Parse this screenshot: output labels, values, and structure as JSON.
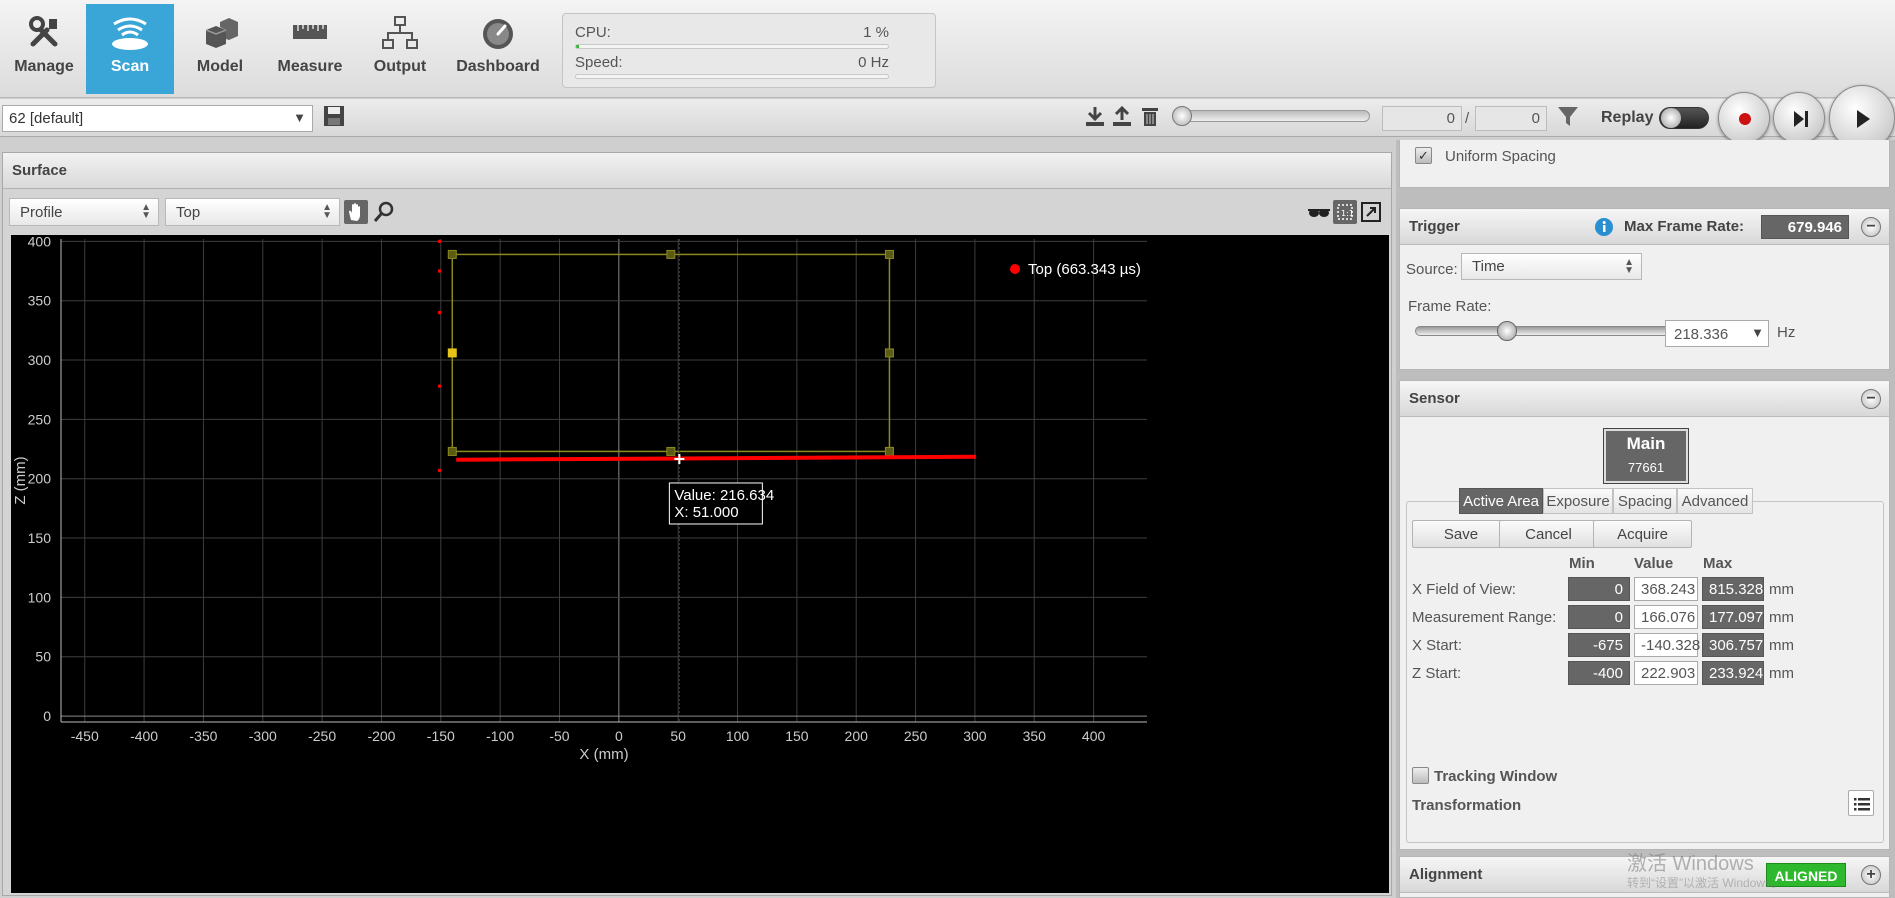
{
  "nav": {
    "items": [
      {
        "label": "Manage",
        "icon": "tools-icon"
      },
      {
        "label": "Scan",
        "icon": "scan-icon"
      },
      {
        "label": "Model",
        "icon": "cubes-icon"
      },
      {
        "label": "Measure",
        "icon": "ruler-icon"
      },
      {
        "label": "Output",
        "icon": "network-icon"
      },
      {
        "label": "Dashboard",
        "icon": "gauge-icon"
      }
    ],
    "active": "Scan"
  },
  "stats": {
    "cpu_label": "CPU:",
    "cpu_value": "1 %",
    "cpu_level": 0.01,
    "speed_label": "Speed:",
    "speed_value": "0 Hz",
    "speed_level": 0
  },
  "toolbar": {
    "job": "62 [default]",
    "frame_current": "0",
    "frame_separator": "/",
    "frame_total": "0",
    "replay_label": "Replay"
  },
  "surface": {
    "title": "Surface",
    "view_mode": "Profile",
    "view_source": "Top"
  },
  "chart_data": {
    "type": "scatter",
    "xlabel": "X (mm)",
    "ylabel": "Z (mm)",
    "xlim": [
      -470,
      445
    ],
    "ylim": [
      -5,
      402
    ],
    "xticks": [
      -450,
      -400,
      -350,
      -300,
      -250,
      -200,
      -150,
      -100,
      -50,
      0,
      50,
      100,
      150,
      200,
      250,
      300,
      350,
      400
    ],
    "yticks": [
      0,
      50,
      100,
      150,
      200,
      250,
      300,
      350,
      400
    ],
    "grid": true,
    "legend": {
      "position": "top-right",
      "label": "Top (663.343 µs)",
      "color": "#ff0000"
    },
    "series": [
      {
        "name": "Top (663.343 µs)",
        "color": "#ff0000",
        "profile_line": {
          "x": [
            -137,
            301
          ],
          "z": [
            216,
            218.5
          ]
        },
        "outliers": [
          {
            "x": -151,
            "z": 400
          },
          {
            "x": -151,
            "z": 375
          },
          {
            "x": -151,
            "z": 340
          },
          {
            "x": -151,
            "z": 278
          },
          {
            "x": -151,
            "z": 207
          }
        ]
      }
    ],
    "roi": {
      "x_start": -140.328,
      "x_end": 228,
      "z_start": 223,
      "z_end": 389,
      "color": "#8a8a1e"
    },
    "cursor": {
      "x": 51.0,
      "z": 216.634
    },
    "tooltip": {
      "value_label": "Value: 216.634",
      "x_label": "X: 51.000"
    }
  },
  "uniform_spacing": {
    "label": "Uniform Spacing",
    "checked": true
  },
  "trigger": {
    "title": "Trigger",
    "max_frame_rate_label": "Max Frame Rate:",
    "max_frame_rate": "679.946",
    "source_label": "Source:",
    "source_value": "Time",
    "frame_rate_label": "Frame Rate:",
    "frame_rate_value": "218.336",
    "frame_rate_unit": "Hz",
    "frame_rate_slider_level": 0.31
  },
  "sensor": {
    "title": "Sensor",
    "device_name": "Main",
    "device_serial": "77661",
    "tabs": [
      "Active Area",
      "Exposure",
      "Spacing",
      "Advanced"
    ],
    "active_tab": "Active Area",
    "buttons": {
      "save": "Save",
      "cancel": "Cancel",
      "acquire": "Acquire"
    },
    "columns": {
      "min": "Min",
      "value": "Value",
      "max": "Max"
    },
    "rows": [
      {
        "label": "X Field of View:",
        "min": "0",
        "value": "368.243",
        "max": "815.328",
        "unit": "mm"
      },
      {
        "label": "Measurement Range:",
        "min": "0",
        "value": "166.076",
        "max": "177.097",
        "unit": "mm"
      },
      {
        "label": "X Start:",
        "min": "-675",
        "value": "-140.328",
        "max": "306.757",
        "unit": "mm"
      },
      {
        "label": "Z Start:",
        "min": "-400",
        "value": "222.903",
        "max": "233.924",
        "unit": "mm"
      }
    ],
    "tracking_window_label": "Tracking Window",
    "tracking_window_checked": false,
    "transformation_label": "Transformation"
  },
  "alignment": {
    "title": "Alignment",
    "status": "ALIGNED",
    "status_color": "#2eb82e"
  },
  "watermark": {
    "line1": "激活 Windows",
    "line2": "转到“设置”以激活 Windows。"
  }
}
